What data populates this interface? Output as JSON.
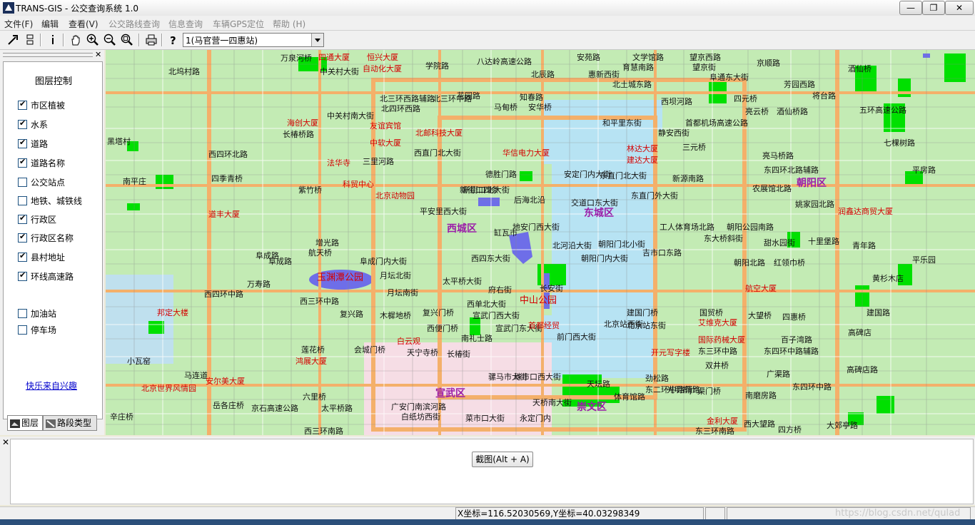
{
  "window": {
    "title": "TRANS-GIS - 公交查询系统 1.0",
    "controls": {
      "minimize": "—",
      "restore": "❐",
      "close": "✕"
    }
  },
  "menu": [
    {
      "label": "文件(F)",
      "enabled": true
    },
    {
      "label": "编辑",
      "enabled": true
    },
    {
      "label": "查看(V)",
      "enabled": true
    },
    {
      "label": "公交路线查询",
      "enabled": false
    },
    {
      "label": "信息查询",
      "enabled": false
    },
    {
      "label": "车辆GPS定位",
      "enabled": false
    },
    {
      "label": "帮助 (H)",
      "enabled": false
    }
  ],
  "toolbar": {
    "icons": [
      "select-arrow-icon",
      "layout-icon",
      "info-icon",
      "pan-hand-icon",
      "zoom-in-icon",
      "zoom-out-icon",
      "zoom-extent-icon",
      "print-icon",
      "help-icon"
    ],
    "route_combo": "1(马官营一四惠站)"
  },
  "layer_panel": {
    "heading": "图层控制",
    "layers": [
      {
        "label": "市区植被",
        "checked": true
      },
      {
        "label": "水系",
        "checked": true
      },
      {
        "label": "道路",
        "checked": true
      },
      {
        "label": "道路名称",
        "checked": true
      },
      {
        "label": "公交站点",
        "checked": false
      },
      {
        "label": "地铁、城铁线",
        "checked": false
      },
      {
        "label": "行政区",
        "checked": true
      },
      {
        "label": "行政区名称",
        "checked": true
      },
      {
        "label": "县村地址",
        "checked": true
      },
      {
        "label": "环线高速路",
        "checked": true
      }
    ],
    "facilities": [
      {
        "label": "加油站",
        "checked": false
      },
      {
        "label": "停车场",
        "checked": false
      }
    ],
    "link": "快乐来自兴趣",
    "tabs": [
      {
        "label": "图层",
        "active": true
      },
      {
        "label": "路段类型",
        "active": false
      }
    ]
  },
  "map": {
    "districts": [
      "西城区",
      "东城区",
      "宣武区",
      "崇文区",
      "朝阳区"
    ],
    "parks": [
      "玉渊潭公园",
      "中山公园"
    ],
    "roads": [
      "万泉河桥",
      "学院路",
      "安苑路",
      "文学馆路",
      "望京西路",
      "京顺路",
      "北坞村路",
      "中关村大街",
      "八达岭高速公路",
      "北辰路",
      "惠新西街",
      "育慧南路",
      "望京街",
      "阜通东大街",
      "酒仙桥",
      "北四环西路",
      "知春路",
      "花园路",
      "马甸桥",
      "安华桥",
      "北土城东路",
      "四元桥",
      "芳园西路",
      "将台路",
      "中关村南大街",
      "北三环西路辅路",
      "北三环中路",
      "西坝河路",
      "首都机场高速公路",
      "亮云桥",
      "酒仙桥路",
      "五环高速公路",
      "长椿桥路",
      "三里河路",
      "西直门北大街",
      "德胜门路",
      "新街口北大街",
      "安定门内大街",
      "东直门北大街",
      "静安西街",
      "和平里东街",
      "三元桥",
      "亮马桥路",
      "七棵树路",
      "东四环北路辅路",
      "平房路",
      "西四环北路",
      "四季青桥",
      "紫竹桥",
      "新街口四条",
      "后海北沿",
      "交道口东大街",
      "东直门外大街",
      "新源南路",
      "农展馆北路",
      "姚家园北路",
      "平安里西大街",
      "地安门西大街",
      "朝阳门北小街",
      "工人体育场北路",
      "东大桥斜街",
      "朝阳公园南路",
      "甜水园街",
      "十里堡路",
      "青年路",
      "阜成路",
      "阜成门内大街",
      "西四东大街",
      "北河沿大街",
      "朝阳门内大街",
      "吉市口东路",
      "朝阳北路",
      "红领巾桥",
      "黄杉木店",
      "太平桥大街",
      "府右街",
      "长安街",
      "北京站西街",
      "建国门桥",
      "国贸桥",
      "大望桥",
      "四惠桥",
      "建国路",
      "西四环中路",
      "万寿路",
      "西三环中路",
      "复兴路",
      "木樨地桥",
      "复兴门桥",
      "宣武门西大街",
      "宣武门东大街",
      "前门西大街",
      "北京站东街",
      "东三环中路",
      "百子湾路",
      "东四环中路辅路",
      "莲花桥",
      "会城门桥",
      "天宁寺桥",
      "长椿街",
      "南礼士路",
      "骡马市大街",
      "珠市口西大街",
      "天桥南大街",
      "天坛路",
      "东二环中路辅路",
      "体育馆路",
      "光明桥",
      "劲松路",
      "广渠门桥",
      "广渠路",
      "南磨房路",
      "小瓦窑",
      "岳各庄桥",
      "六里桥",
      "京石高速公路",
      "太平桥路",
      "广安门南滨河路",
      "白纸坊西街",
      "菜市口大街",
      "永定门内",
      "西三环南路",
      "东三环南路",
      "西大望路",
      "四方桥",
      "大郊亭路",
      "东四环中路",
      "高碑店",
      "高碑店路",
      "辛庄桥",
      "双井桥",
      "平乐园",
      "南平庄",
      "黑塔村",
      "阜成路",
      "增光路",
      "航天桥",
      "月坛南街",
      "月坛北街",
      "西便门桥",
      "西单北大街",
      "缸瓦市",
      "马连道"
    ],
    "landmarks": [
      "四通大厦",
      "恒兴大厦",
      "自动化大厦",
      "海创大厦",
      "北邮科技大厦",
      "友谊宾馆",
      "中软大厦",
      "华信电力大厦",
      "林达大厦",
      "建达大厦",
      "科贸中心",
      "北京动物园",
      "道丰大厦",
      "开元写字楼",
      "金利大厦",
      "鸿展大厦",
      "北京世界风情园",
      "安尔美大厦",
      "邦定大楼",
      "首都经贸",
      "艾维克大厦",
      "国际药械大厦",
      "航空大厦",
      "润鑫达商贸大厦",
      "白云观",
      "法华寺"
    ]
  },
  "bottom_panel": {
    "capture_button": "截图(Alt + A)"
  },
  "status": {
    "coords": "X坐标=116.52030569,Y坐标=40.03298349"
  },
  "watermark": "https://blog.csdn.net/qulad",
  "colors": {
    "map_background": "#c3ebb4",
    "district_east": "#b7e3f3",
    "district_xuanwu": "#f6dde5",
    "road": "#f4b06a",
    "water": "#6e6ee8",
    "vegetation": "#00e000",
    "district_label": "#9b1ca8",
    "landmark_label": "#d40000"
  }
}
